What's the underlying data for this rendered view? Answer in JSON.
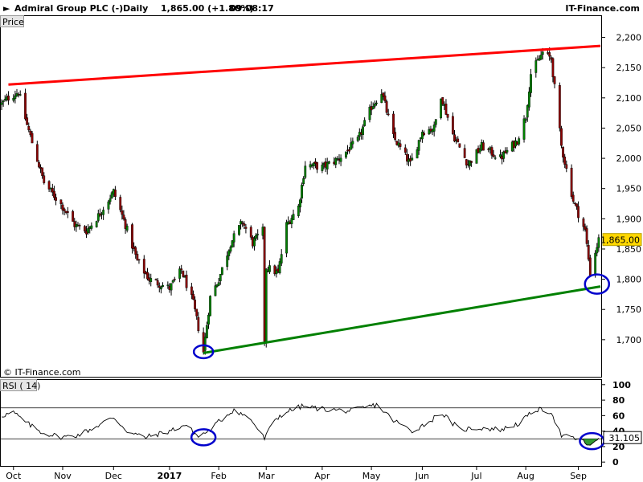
{
  "header": {
    "title": "Admiral Group PLC (-)",
    "timeframe": "Daily",
    "quote": "1,865.00 (+1.80%)",
    "time": "09:08:17",
    "brand": "IT-Finance.com"
  },
  "watermark": "© IT-Finance.com",
  "chart_data": [
    {
      "type": "candlestick",
      "panel_label": "Price",
      "ylim": [
        1640,
        2230
      ],
      "yticks": [
        {
          "value": 1700,
          "label": "1,700"
        },
        {
          "value": 1750,
          "label": "1,750"
        },
        {
          "value": 1800,
          "label": "1,800"
        },
        {
          "value": 1850,
          "label": "1,850"
        },
        {
          "value": 1900,
          "label": "1,900"
        },
        {
          "value": 1950,
          "label": "1,950"
        },
        {
          "value": 2000,
          "label": "2,000"
        },
        {
          "value": 2050,
          "label": "2,050"
        },
        {
          "value": 2100,
          "label": "2,100"
        },
        {
          "value": 2150,
          "label": "2,150"
        },
        {
          "value": 2200,
          "label": "2,200"
        }
      ],
      "last_price": {
        "value": 1865,
        "label": "1,865.00",
        "color": "#ffd700"
      },
      "x_range": [
        "2016-09-26",
        "2017-09-14"
      ],
      "xticks": [
        {
          "date": "2016-10-03",
          "label": "Oct",
          "bold": false
        },
        {
          "date": "2016-11-01",
          "label": "Nov",
          "bold": false
        },
        {
          "date": "2016-12-01",
          "label": "Dec",
          "bold": false
        },
        {
          "date": "2017-01-03",
          "label": "2017",
          "bold": true
        },
        {
          "date": "2017-02-01",
          "label": "Feb",
          "bold": false
        },
        {
          "date": "2017-03-01",
          "label": "Mar",
          "bold": false
        },
        {
          "date": "2017-04-03",
          "label": "Apr",
          "bold": false
        },
        {
          "date": "2017-05-02",
          "label": "May",
          "bold": false
        },
        {
          "date": "2017-06-01",
          "label": "Jun",
          "bold": false
        },
        {
          "date": "2017-07-03",
          "label": "Jul",
          "bold": false
        },
        {
          "date": "2017-08-01",
          "label": "Aug",
          "bold": false
        },
        {
          "date": "2017-09-01",
          "label": "Sep",
          "bold": false
        }
      ],
      "close_path": [
        [
          "2016-09-26",
          2090
        ],
        [
          "2016-09-30",
          2100
        ],
        [
          "2016-10-06",
          2110
        ],
        [
          "2016-10-11",
          2055
        ],
        [
          "2016-10-21",
          1960
        ],
        [
          "2016-11-01",
          1920
        ],
        [
          "2016-11-08",
          1890
        ],
        [
          "2016-11-15",
          1880
        ],
        [
          "2016-11-22",
          1905
        ],
        [
          "2016-12-01",
          1945
        ],
        [
          "2016-12-08",
          1890
        ],
        [
          "2016-12-15",
          1830
        ],
        [
          "2016-12-22",
          1800
        ],
        [
          "2017-01-03",
          1785
        ],
        [
          "2017-01-10",
          1815
        ],
        [
          "2017-01-17",
          1760
        ],
        [
          "2017-01-23",
          1680
        ],
        [
          "2017-01-27",
          1770
        ],
        [
          "2017-02-01",
          1800
        ],
        [
          "2017-02-08",
          1860
        ],
        [
          "2017-02-15",
          1895
        ],
        [
          "2017-02-21",
          1860
        ],
        [
          "2017-02-27",
          1880
        ],
        [
          "2017-02-28",
          1700
        ],
        [
          "2017-03-01",
          1820
        ],
        [
          "2017-03-08",
          1810
        ],
        [
          "2017-03-13",
          1890
        ],
        [
          "2017-03-20",
          1920
        ],
        [
          "2017-03-24",
          1990
        ],
        [
          "2017-04-03",
          1985
        ],
        [
          "2017-04-13",
          2000
        ],
        [
          "2017-04-24",
          2030
        ],
        [
          "2017-05-02",
          2085
        ],
        [
          "2017-05-08",
          2110
        ],
        [
          "2017-05-15",
          2035
        ],
        [
          "2017-05-25",
          1990
        ],
        [
          "2017-06-01",
          2045
        ],
        [
          "2017-06-08",
          2050
        ],
        [
          "2017-06-12",
          2105
        ],
        [
          "2017-06-19",
          2040
        ],
        [
          "2017-06-28",
          1990
        ],
        [
          "2017-07-06",
          2020
        ],
        [
          "2017-07-17",
          2000
        ],
        [
          "2017-07-27",
          2030
        ],
        [
          "2017-08-01",
          2070
        ],
        [
          "2017-08-04",
          2140
        ],
        [
          "2017-08-11",
          2175
        ],
        [
          "2017-08-16",
          2165
        ],
        [
          "2017-08-22",
          2020
        ],
        [
          "2017-08-29",
          1930
        ],
        [
          "2017-09-05",
          1880
        ],
        [
          "2017-09-08",
          1810
        ],
        [
          "2017-09-11",
          1845
        ],
        [
          "2017-09-13",
          1865
        ]
      ],
      "trendlines": [
        {
          "name": "resistance",
          "color": "#ff0000",
          "from": [
            "2016-09-30",
            2122
          ],
          "to": [
            "2017-09-14",
            2186
          ]
        },
        {
          "name": "support",
          "color": "#008000",
          "from": [
            "2017-01-23",
            1678
          ],
          "to": [
            "2017-09-14",
            1788
          ]
        }
      ],
      "circles": [
        {
          "date": "2017-01-23",
          "value": 1680,
          "color": "#0000cc"
        },
        {
          "date": "2017-09-12",
          "value": 1792,
          "color": "#0000cc"
        }
      ],
      "colors": {
        "up": "#008000",
        "down": "#8b0000",
        "wick": "#000000"
      }
    },
    {
      "type": "line",
      "panel_label": "RSI ( 14)",
      "ylim": [
        -5,
        105
      ],
      "yticks": [
        {
          "value": 0,
          "label": "0",
          "bold": true
        },
        {
          "value": 20,
          "label": "20",
          "bold": true
        },
        {
          "value": 40,
          "label": "40",
          "bold": true
        },
        {
          "value": 60,
          "label": "60",
          "bold": true
        },
        {
          "value": 80,
          "label": "80",
          "bold": true
        },
        {
          "value": 100,
          "label": "100",
          "bold": true
        }
      ],
      "levels": [
        70,
        30
      ],
      "last_value": {
        "value": 31.105,
        "label": "31.105"
      },
      "series_path": [
        [
          "2016-09-26",
          60
        ],
        [
          "2016-10-03",
          64
        ],
        [
          "2016-10-11",
          50
        ],
        [
          "2016-10-20",
          38
        ],
        [
          "2016-11-01",
          32
        ],
        [
          "2016-11-10",
          35
        ],
        [
          "2016-11-20",
          45
        ],
        [
          "2016-12-01",
          58
        ],
        [
          "2016-12-10",
          38
        ],
        [
          "2016-12-20",
          32
        ],
        [
          "2017-01-03",
          40
        ],
        [
          "2017-01-12",
          48
        ],
        [
          "2017-01-20",
          33
        ],
        [
          "2017-01-26",
          40
        ],
        [
          "2017-02-01",
          52
        ],
        [
          "2017-02-10",
          68
        ],
        [
          "2017-02-20",
          55
        ],
        [
          "2017-02-28",
          30
        ],
        [
          "2017-03-06",
          55
        ],
        [
          "2017-03-13",
          65
        ],
        [
          "2017-03-22",
          72
        ],
        [
          "2017-04-05",
          68
        ],
        [
          "2017-04-20",
          66
        ],
        [
          "2017-05-05",
          74
        ],
        [
          "2017-05-15",
          54
        ],
        [
          "2017-05-26",
          40
        ],
        [
          "2017-06-05",
          52
        ],
        [
          "2017-06-12",
          64
        ],
        [
          "2017-06-23",
          42
        ],
        [
          "2017-07-05",
          44
        ],
        [
          "2017-07-18",
          42
        ],
        [
          "2017-07-28",
          50
        ],
        [
          "2017-08-07",
          68
        ],
        [
          "2017-08-16",
          65
        ],
        [
          "2017-08-22",
          34
        ],
        [
          "2017-08-31",
          30
        ],
        [
          "2017-09-06",
          24
        ],
        [
          "2017-09-09",
          18
        ],
        [
          "2017-09-13",
          31.105
        ]
      ],
      "circles": [
        {
          "date": "2017-01-23",
          "value": 32,
          "color": "#0000cc"
        },
        {
          "date": "2017-09-09",
          "value": 27,
          "color": "#0000cc"
        }
      ],
      "color": "#000000",
      "fill_below_color": "#008000"
    }
  ]
}
